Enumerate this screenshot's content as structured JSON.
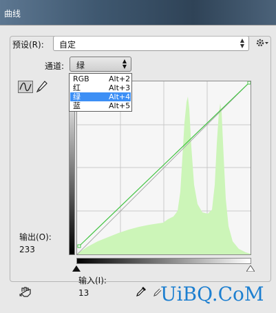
{
  "window": {
    "title": "曲线"
  },
  "preset": {
    "label": "预设(R):",
    "value": "自定"
  },
  "channel": {
    "label": "通道:",
    "value": "绿",
    "menu": [
      {
        "name": "RGB",
        "shortcut": "Alt+2"
      },
      {
        "name": "红",
        "shortcut": "Alt+3"
      },
      {
        "name": "绿",
        "shortcut": "Alt+4",
        "selected": true
      },
      {
        "name": "蓝",
        "shortcut": "Alt+5"
      }
    ]
  },
  "output": {
    "label": "输出(O):",
    "value": "233"
  },
  "input": {
    "label": "输入(I):",
    "value": "13"
  },
  "curve": {
    "points": [
      [
        13,
        0
      ],
      [
        255,
        255
      ]
    ],
    "histogram_color": "#ccf5b8",
    "curve_color": "#43c443"
  },
  "watermark": {
    "text": "UiBQ.CoM"
  }
}
